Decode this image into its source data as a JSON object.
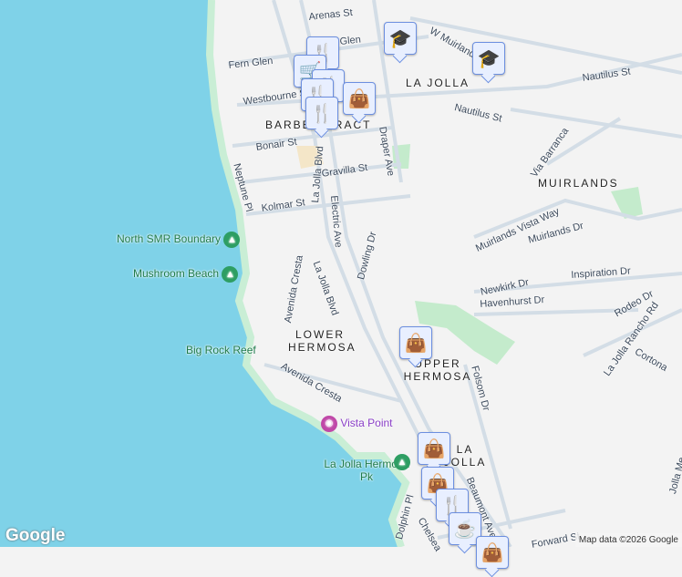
{
  "map": {
    "colors": {
      "water": "#7fd2e8",
      "land": "#f3f3f3",
      "park": "#bfe8c8",
      "road": "#d3dde6",
      "shore": "#c9eed5"
    },
    "areas": [
      "LA JOLLA",
      "BARBER TRACT",
      "MUIRLANDS",
      "LOWER HERMOSA",
      "UPPER HERMOSA",
      "LA JOLLA HERMOSA"
    ],
    "streets": [
      "Arenas St",
      "Fern Glen",
      "W Muirlands",
      "Westbourne St",
      "Nautilus St",
      "Bonair St",
      "Draper Ave",
      "Via Barranca",
      "Gravilla St",
      "Neptune Pl",
      "La Jolla Blvd",
      "Kolmar St",
      "Electric Ave",
      "Muirlands Vista Way",
      "Muirlands Dr",
      "Dowling Dr",
      "Newkirk Dr",
      "Inspiration Dr",
      "Havenhurst Dr",
      "Rodeo Dr",
      "Avenida Cresta",
      "La Jolla Blvd",
      "La Jolla Rancho Rd",
      "Folsom Dr",
      "Cortona",
      "Avenida Cresta",
      "Dolphin Pl",
      "Chelsea",
      "Beaumont Ave",
      "Forward St",
      "Jolla Me",
      "Glen"
    ],
    "pois": [
      {
        "name": "North SMR Boundary",
        "icon": "tree-icon"
      },
      {
        "name": "Mushroom Beach",
        "icon": "tree-icon"
      },
      {
        "name": "Big Rock Reef",
        "icon": "none"
      },
      {
        "name": "Vista Point",
        "icon": "camera-icon"
      },
      {
        "name": "La Jolla Hermosa Pk",
        "icon": "tree-icon"
      }
    ],
    "markers": [
      "school",
      "school",
      "grocery",
      "restaurant",
      "restaurant",
      "restaurant",
      "shopping",
      "shopping",
      "shopping",
      "restaurant",
      "cafe"
    ]
  },
  "logo": "Google",
  "attribution": "Map data ©2026 Google"
}
